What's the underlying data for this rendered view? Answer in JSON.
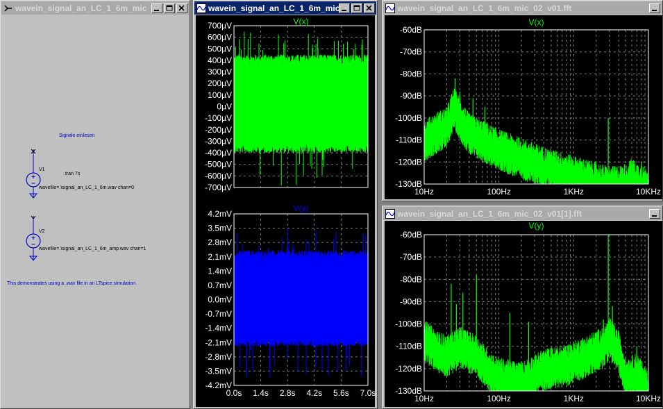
{
  "windows": {
    "schematic": {
      "title": "wavein_signal_an_LC_1_6m_mic"
    },
    "waveform": {
      "title": "wavein_signal_an_LC_1_6m_mic"
    },
    "fft1": {
      "title": "wavein_signal_an_LC_1_6m_mic_02_v01.fft"
    },
    "fft2": {
      "title": "wavein_signal_an_LC_1_6m_mic_02_v01[1].fft"
    }
  },
  "schematic": {
    "heading": "Signale einlesen",
    "directive": ".tran 7s",
    "v1_name": "V1",
    "v1_value": "wavefile=.\\signal_an_LC_1_6m.wav chan=0",
    "v2_name": "V2",
    "v2_value": "wavefile=.\\signal_an_LC_1_6m_amp.wav chan=1",
    "note": "This demonstrates using a .wav file in an LTspice simulation."
  },
  "colors": {
    "plot_bg": "#000000",
    "trace_green": "#00ff00",
    "trace_blue": "#0000ff",
    "grid": "#808080",
    "text_blue": "#0000cc"
  },
  "chart_data": [
    {
      "type": "line",
      "title": "V(x)",
      "series": [
        {
          "name": "V(x)",
          "color": "#00ff00"
        }
      ],
      "x_ticks": [
        "0.0s",
        "1.4s",
        "2.8s",
        "4.2s",
        "5.6s",
        "7.0s"
      ],
      "y_ticks": [
        "700µV",
        "600µV",
        "500µV",
        "400µV",
        "300µV",
        "200µV",
        "100µV",
        "0µV",
        "-100µV",
        "-200µV",
        "-300µV",
        "-400µV",
        "-500µV",
        "-600µV",
        "-700µV"
      ],
      "xlim": [
        0,
        7
      ],
      "ylim": [
        -700,
        700
      ],
      "envelope": {
        "typical_low": -400,
        "typical_high": 450,
        "peak_low": -700,
        "peak_high": 660
      }
    },
    {
      "type": "line",
      "title": "V(y)",
      "series": [
        {
          "name": "V(y)",
          "color": "#0000ff"
        }
      ],
      "x_ticks": [
        "0.0s",
        "1.4s",
        "2.8s",
        "4.2s",
        "5.6s",
        "7.0s"
      ],
      "y_ticks": [
        "4.2mV",
        "3.5mV",
        "2.8mV",
        "2.1mV",
        "1.4mV",
        "0.7mV",
        "0.0mV",
        "-0.7mV",
        "-1.4mV",
        "-2.1mV",
        "-2.8mV",
        "-3.5mV",
        "-4.2mV"
      ],
      "xlim": [
        0,
        7
      ],
      "ylim": [
        -4.2,
        4.2
      ],
      "envelope": {
        "typical_low": -2.3,
        "typical_high": 2.4,
        "peak_low": -4.0,
        "peak_high": 3.5
      }
    },
    {
      "type": "line",
      "title": "V(x)",
      "series": [
        {
          "name": "V(x)",
          "color": "#00ff00"
        }
      ],
      "x_ticks": [
        "10Hz",
        "100Hz",
        "1KHz",
        "10KHz"
      ],
      "y_ticks": [
        "-60dB",
        "-70dB",
        "-80dB",
        "-90dB",
        "-100dB",
        "-110dB",
        "-120dB",
        "-130dB"
      ],
      "xscale": "log",
      "xlim": [
        10,
        10000
      ],
      "ylim": [
        -130,
        -60
      ],
      "points": [
        [
          10,
          -108
        ],
        [
          15,
          -104
        ],
        [
          20,
          -102
        ],
        [
          25,
          -93
        ],
        [
          30,
          -98
        ],
        [
          40,
          -105
        ],
        [
          60,
          -108
        ],
        [
          100,
          -112
        ],
        [
          200,
          -116
        ],
        [
          400,
          -120
        ],
        [
          1000,
          -124
        ],
        [
          2000,
          -127
        ],
        [
          3000,
          -129
        ],
        [
          5000,
          -128
        ],
        [
          6000,
          -125
        ],
        [
          7000,
          -127
        ],
        [
          10000,
          -130
        ]
      ],
      "spikes": [
        [
          26,
          -82
        ],
        [
          30,
          -88
        ],
        [
          45,
          -91
        ],
        [
          65,
          -95
        ],
        [
          2900,
          -100
        ],
        [
          4800,
          -121
        ],
        [
          8100,
          -120
        ]
      ]
    },
    {
      "type": "line",
      "title": "V(y)",
      "series": [
        {
          "name": "V(y)",
          "color": "#00ff00"
        }
      ],
      "x_ticks": [
        "10Hz",
        "100Hz",
        "1KHz",
        "10KHz"
      ],
      "y_ticks": [
        "-60dB",
        "-70dB",
        "-80dB",
        "-90dB",
        "-100dB",
        "-110dB",
        "-120dB",
        "-130dB"
      ],
      "xscale": "log",
      "xlim": [
        10,
        10000
      ],
      "ylim": [
        -130,
        -60
      ],
      "points": [
        [
          10,
          -105
        ],
        [
          15,
          -110
        ],
        [
          20,
          -112
        ],
        [
          30,
          -108
        ],
        [
          50,
          -112
        ],
        [
          80,
          -120
        ],
        [
          100,
          -122
        ],
        [
          200,
          -124
        ],
        [
          400,
          -118
        ],
        [
          800,
          -116
        ],
        [
          1500,
          -112
        ],
        [
          2500,
          -108
        ],
        [
          3000,
          -104
        ],
        [
          4000,
          -110
        ],
        [
          5000,
          -122
        ],
        [
          7000,
          -120
        ],
        [
          10000,
          -128
        ]
      ],
      "spikes": [
        [
          23,
          -82
        ],
        [
          27,
          -91
        ],
        [
          33,
          -86
        ],
        [
          50,
          -78
        ],
        [
          140,
          -95
        ],
        [
          250,
          -99
        ],
        [
          2900,
          -60
        ],
        [
          2500,
          -98
        ],
        [
          3300,
          -92
        ],
        [
          7000,
          -110
        ]
      ]
    }
  ]
}
